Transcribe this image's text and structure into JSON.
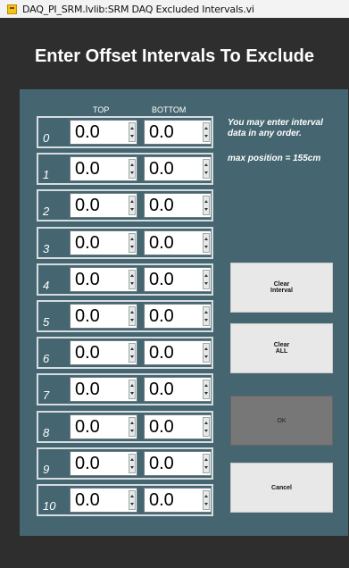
{
  "window": {
    "title": "DAQ_PI_SRM.lvlib:SRM DAQ Excluded Intervals.vi"
  },
  "heading": "Enter Offset Intervals To Exclude",
  "columns": {
    "top": "TOP",
    "bottom": "BOTTOM"
  },
  "rows": [
    {
      "index": "0",
      "top": "0.0",
      "bottom": "0.0"
    },
    {
      "index": "1",
      "top": "0.0",
      "bottom": "0.0"
    },
    {
      "index": "2",
      "top": "0.0",
      "bottom": "0.0"
    },
    {
      "index": "3",
      "top": "0.0",
      "bottom": "0.0"
    },
    {
      "index": "4",
      "top": "0.0",
      "bottom": "0.0"
    },
    {
      "index": "5",
      "top": "0.0",
      "bottom": "0.0"
    },
    {
      "index": "6",
      "top": "0.0",
      "bottom": "0.0"
    },
    {
      "index": "7",
      "top": "0.0",
      "bottom": "0.0"
    },
    {
      "index": "8",
      "top": "0.0",
      "bottom": "0.0"
    },
    {
      "index": "9",
      "top": "0.0",
      "bottom": "0.0"
    },
    {
      "index": "10",
      "top": "0.0",
      "bottom": "0.0"
    }
  ],
  "notes": {
    "order": "You may enter interval data in any order.",
    "max_position": "max position = 155cm"
  },
  "buttons": {
    "clear_interval": "Clear\nInterval",
    "clear_all": "Clear\nALL",
    "ok": "OK",
    "cancel": "Cancel"
  },
  "colors": {
    "panel": "#456670",
    "background": "#2e2e2e"
  }
}
